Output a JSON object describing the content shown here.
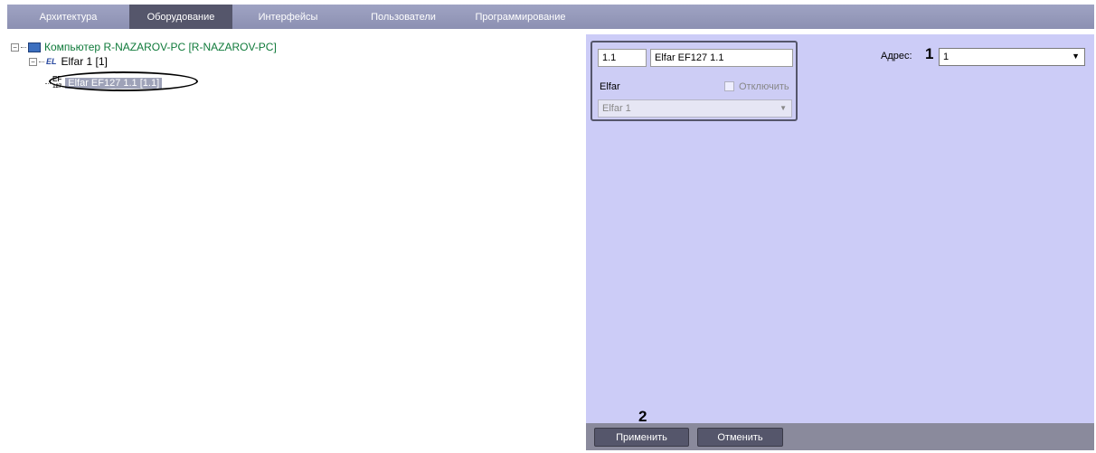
{
  "tabs": [
    {
      "label": "Архитектура",
      "active": false
    },
    {
      "label": "Оборудование",
      "active": true
    },
    {
      "label": "Интерфейсы",
      "active": false
    },
    {
      "label": "Пользователи",
      "active": false
    },
    {
      "label": "Программирование",
      "active": false
    }
  ],
  "tree": {
    "computer": {
      "expander": "−",
      "label": "Компьютер R-NAZAROV-PC [R-NAZAROV-PC]",
      "icon": "computer-icon"
    },
    "elfar": {
      "expander": "−",
      "icon_text": "EL",
      "label": "Elfar 1 [1]"
    },
    "reader": {
      "icon_text_top": "EF",
      "icon_text_bottom": "127",
      "label": "Elfar EF127 1.1 [1.1]"
    }
  },
  "device": {
    "id": "1.1",
    "name": "Elfar EF127 1.1",
    "type_label": "Elfar",
    "disable_label": "Отключить",
    "parent_value": "Elfar 1",
    "dropdown_arrow": "▼"
  },
  "address": {
    "label": "Адрес:",
    "value": "1",
    "arrow": "▼"
  },
  "annotations": {
    "one": "1",
    "two": "2"
  },
  "buttons": {
    "apply": "Применить",
    "cancel": "Отменить"
  },
  "colors": {
    "tab_bar": "#9fa3c3",
    "active_tab": "#55566b",
    "panel": "#ccccf7",
    "tree_green": "#0f7a3a"
  }
}
